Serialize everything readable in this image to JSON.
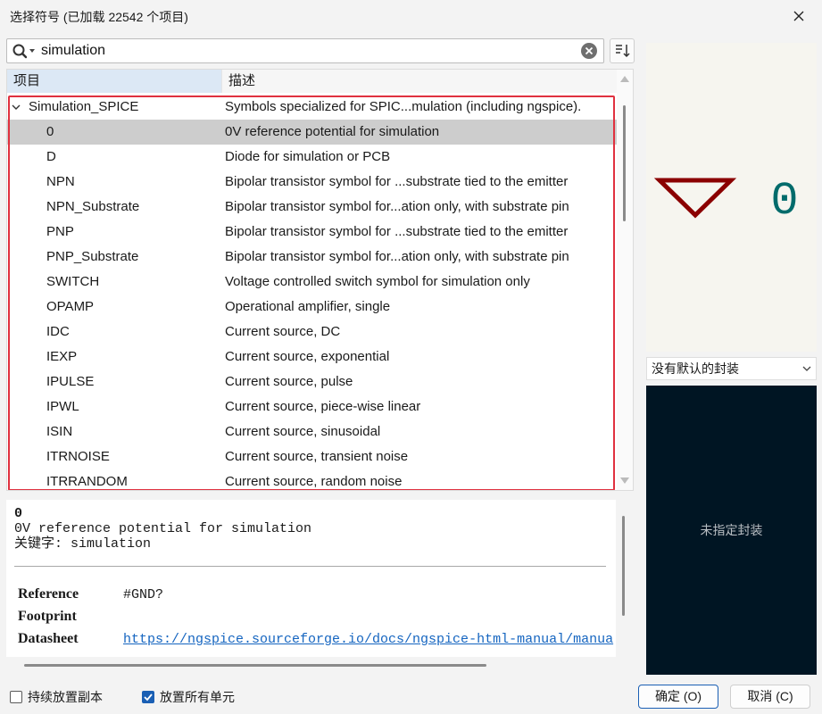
{
  "window": {
    "title": "选择符号 (已加载 22542 个项目)"
  },
  "search": {
    "value": "simulation"
  },
  "tree": {
    "header": {
      "name": "项目",
      "description": "描述"
    },
    "library": {
      "name": "Simulation_SPICE",
      "description": "Symbols specialized for SPIC...mulation (including ngspice)."
    },
    "rows": [
      {
        "name": "0",
        "description": "0V reference potential for simulation",
        "selected": true
      },
      {
        "name": "D",
        "description": "Diode for simulation or PCB"
      },
      {
        "name": "NPN",
        "description": "Bipolar transistor symbol for ...substrate tied to the emitter"
      },
      {
        "name": "NPN_Substrate",
        "description": "Bipolar transistor symbol for...ation only, with substrate pin"
      },
      {
        "name": "PNP",
        "description": "Bipolar transistor symbol for ...substrate tied to the emitter"
      },
      {
        "name": "PNP_Substrate",
        "description": "Bipolar transistor symbol for...ation only, with substrate pin"
      },
      {
        "name": "SWITCH",
        "description": "Voltage controlled switch symbol for simulation only"
      },
      {
        "name": "OPAMP",
        "description": "Operational amplifier, single"
      },
      {
        "name": "IDC",
        "description": "Current source, DC"
      },
      {
        "name": "IEXP",
        "description": "Current source, exponential"
      },
      {
        "name": "IPULSE",
        "description": "Current source, pulse"
      },
      {
        "name": "IPWL",
        "description": "Current source, piece-wise linear"
      },
      {
        "name": "ISIN",
        "description": "Current source, sinusoidal"
      },
      {
        "name": "ITRNOISE",
        "description": "Current source, transient noise"
      },
      {
        "name": "ITRRANDOM",
        "description": "Current source, random noise"
      }
    ]
  },
  "details": {
    "name": "0",
    "description": "0V reference potential for simulation",
    "keywords": "关键字: simulation",
    "fields": {
      "reference_label": "Reference",
      "reference_value": "#GND?",
      "footprint_label": "Footprint",
      "datasheet_label": "Datasheet",
      "datasheet_value": "https://ngspice.sourceforge.io/docs/ngspice-html-manual/manua"
    }
  },
  "preview": {
    "symbol_value": "0",
    "symbol_color": "#8b0000",
    "text_color": "#006b6b"
  },
  "footprint": {
    "select_value": "没有默认的封装",
    "unassigned_message": "未指定封装"
  },
  "footer": {
    "keep_placing": {
      "label": "持续放置副本",
      "checked": false
    },
    "place_all_units": {
      "label": "放置所有单元",
      "checked": true
    },
    "ok_label": "确定 (O)",
    "cancel_label": "取消 (C)"
  }
}
